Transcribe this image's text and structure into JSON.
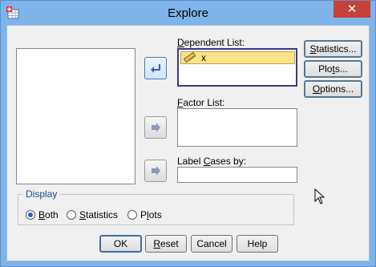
{
  "window": {
    "title": "Explore",
    "close_glyph": "✕"
  },
  "source_list": {
    "items": []
  },
  "dependent_list": {
    "label_pre": "",
    "label_key": "D",
    "label_post": "ependent List:",
    "items": [
      {
        "name": "x",
        "icon": "ruler-scale-icon"
      }
    ]
  },
  "factor_list": {
    "label_pre": "",
    "label_key": "F",
    "label_post": "actor List:",
    "items": []
  },
  "label_cases": {
    "label_pre": "Label ",
    "label_key": "C",
    "label_post": "ases by:",
    "value": ""
  },
  "side_buttons": {
    "statistics": {
      "pre": "",
      "key": "S",
      "post": "tatistics..."
    },
    "plots": {
      "pre": "Plo",
      "key": "t",
      "post": "s..."
    },
    "options": {
      "pre": "",
      "key": "O",
      "post": "ptions..."
    }
  },
  "display": {
    "title": "Display",
    "selected": "Both",
    "options": [
      {
        "pre": "",
        "key": "B",
        "post": "oth"
      },
      {
        "pre": "",
        "key": "S",
        "post": "tatistics"
      },
      {
        "pre": "P",
        "key": "l",
        "post": "ots"
      }
    ]
  },
  "footer_buttons": {
    "ok": {
      "label": "OK"
    },
    "reset": {
      "pre": "",
      "key": "R",
      "post": "eset"
    },
    "cancel": {
      "label": "Cancel"
    },
    "help": {
      "label": "Help"
    }
  },
  "colors": {
    "title_bar": "#7eb4ea",
    "close_button": "#c7403a",
    "selection": "#fbe38a",
    "group_title": "#1a4d8f"
  }
}
